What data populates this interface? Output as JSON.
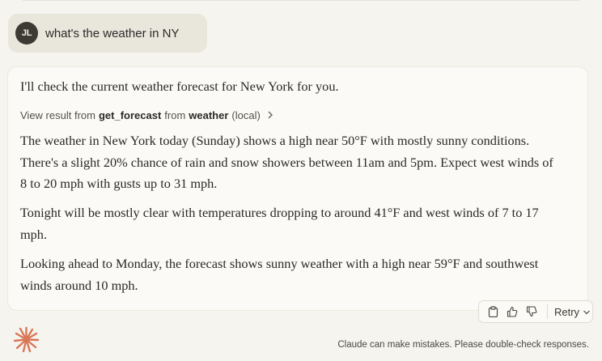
{
  "user_message": {
    "avatar_initials": "JL",
    "text": "what's the weather in NY"
  },
  "assistant_message": {
    "intro": "I'll check the current weather forecast for New York for you.",
    "tool_call": {
      "prefix": "View result from",
      "tool_name": "get_forecast",
      "middle": "from",
      "server_name": "weather",
      "suffix": "(local)",
      "icon": "chevron-right-icon"
    },
    "paragraphs": [
      "The weather in New York today (Sunday) shows a high near 50°F with mostly sunny conditions. There's a slight 20% chance of rain and snow showers between 11am and 5pm. Expect west winds of 8 to 20 mph with gusts up to 31 mph.",
      "Tonight will be mostly clear with temperatures dropping to around 41°F and west winds of 7 to 17 mph.",
      "Looking ahead to Monday, the forecast shows sunny weather with a high near 59°F and southwest winds around 10 mph."
    ]
  },
  "actions": {
    "copy_icon": "copy-icon",
    "thumbs_up_icon": "thumbs-up-icon",
    "thumbs_down_icon": "thumbs-down-icon",
    "retry_label": "Retry"
  },
  "footer": {
    "disclaimer": "Claude can make mistakes. Please double-check responses."
  },
  "colors": {
    "background": "#f5f4ef",
    "user_bubble": "#e9e6dc",
    "reply_card": "#fbfaf6",
    "brand": "#d97757"
  }
}
